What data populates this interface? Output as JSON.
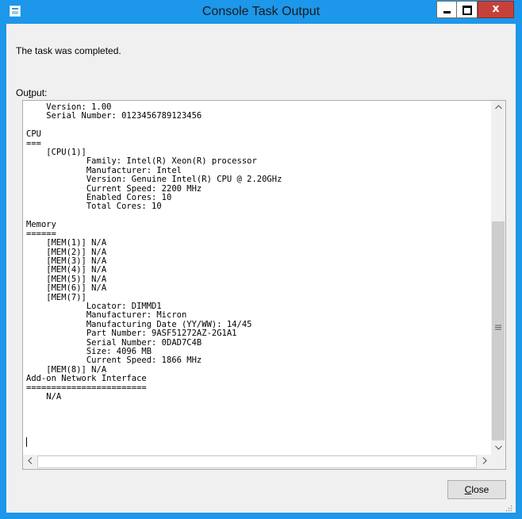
{
  "window": {
    "title": "Console Task Output",
    "minimize_label": "Minimize",
    "maximize_label": "Maximize",
    "close_glyph": "x"
  },
  "status_text": "The task was completed.",
  "output": {
    "label_prefix": "Ou",
    "label_accel": "t",
    "label_suffix": "put:",
    "text": "    Version: 1.00\n    Serial Number: 0123456789123456\n\nCPU\n===\n    [CPU(1)]\n            Family: Intel(R) Xeon(R) processor\n            Manufacturer: Intel\n            Version: Genuine Intel(R) CPU @ 2.20GHz\n            Current Speed: 2200 MHz\n            Enabled Cores: 10\n            Total Cores: 10\n\nMemory\n======\n    [MEM(1)] N/A\n    [MEM(2)] N/A\n    [MEM(3)] N/A\n    [MEM(4)] N/A\n    [MEM(5)] N/A\n    [MEM(6)] N/A\n    [MEM(7)]\n            Locator: DIMMD1\n            Manufacturer: Micron\n            Manufacturing Date (YY/WW): 14/45\n            Part Number: 9ASF51272AZ-2G1A1\n            Serial Number: 0DAD7C4B\n            Size: 4096 MB\n            Current Speed: 1866 MHz\n    [MEM(8)] N/A\nAdd-on Network Interface\n========================\n    N/A\n"
  },
  "icons": {
    "app": "console-window-icon",
    "scroll_up": "chevron-up-icon",
    "scroll_down": "chevron-down-icon",
    "scroll_left": "chevron-left-icon",
    "scroll_right": "chevron-right-icon",
    "grip": "scroll-grip-icon"
  },
  "close_button": {
    "accel": "C",
    "rest": "lose"
  },
  "colors": {
    "titlebar": "#1c97ea",
    "close_red": "#c7413c"
  }
}
